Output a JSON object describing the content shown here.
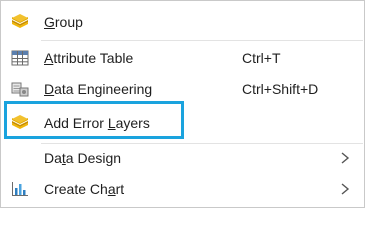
{
  "menu": {
    "items": [
      {
        "pre": "",
        "ul": "G",
        "post": "roup",
        "shortcut": "",
        "submenu": false,
        "icon": "layers-icon"
      },
      {
        "pre": "",
        "ul": "A",
        "post": "ttribute Table",
        "shortcut": "Ctrl+T",
        "submenu": false,
        "icon": "table-icon"
      },
      {
        "pre": "",
        "ul": "D",
        "post": "ata Engineering",
        "shortcut": "Ctrl+Shift+D",
        "submenu": false,
        "icon": "data-engineering-icon"
      },
      {
        "pre": "Add Error ",
        "ul": "L",
        "post": "ayers",
        "shortcut": "",
        "submenu": false,
        "icon": "layers-icon"
      },
      {
        "pre": "Da",
        "ul": "t",
        "post": "a Design",
        "shortcut": "",
        "submenu": true,
        "icon": ""
      },
      {
        "pre": "Create Ch",
        "ul": "a",
        "post": "rt",
        "shortcut": "",
        "submenu": true,
        "icon": "bar-chart-icon"
      }
    ]
  },
  "colors": {
    "highlight_border": "#1aa3de",
    "layers_yellow": "#f2b705",
    "separator": "#e3e3e3"
  }
}
